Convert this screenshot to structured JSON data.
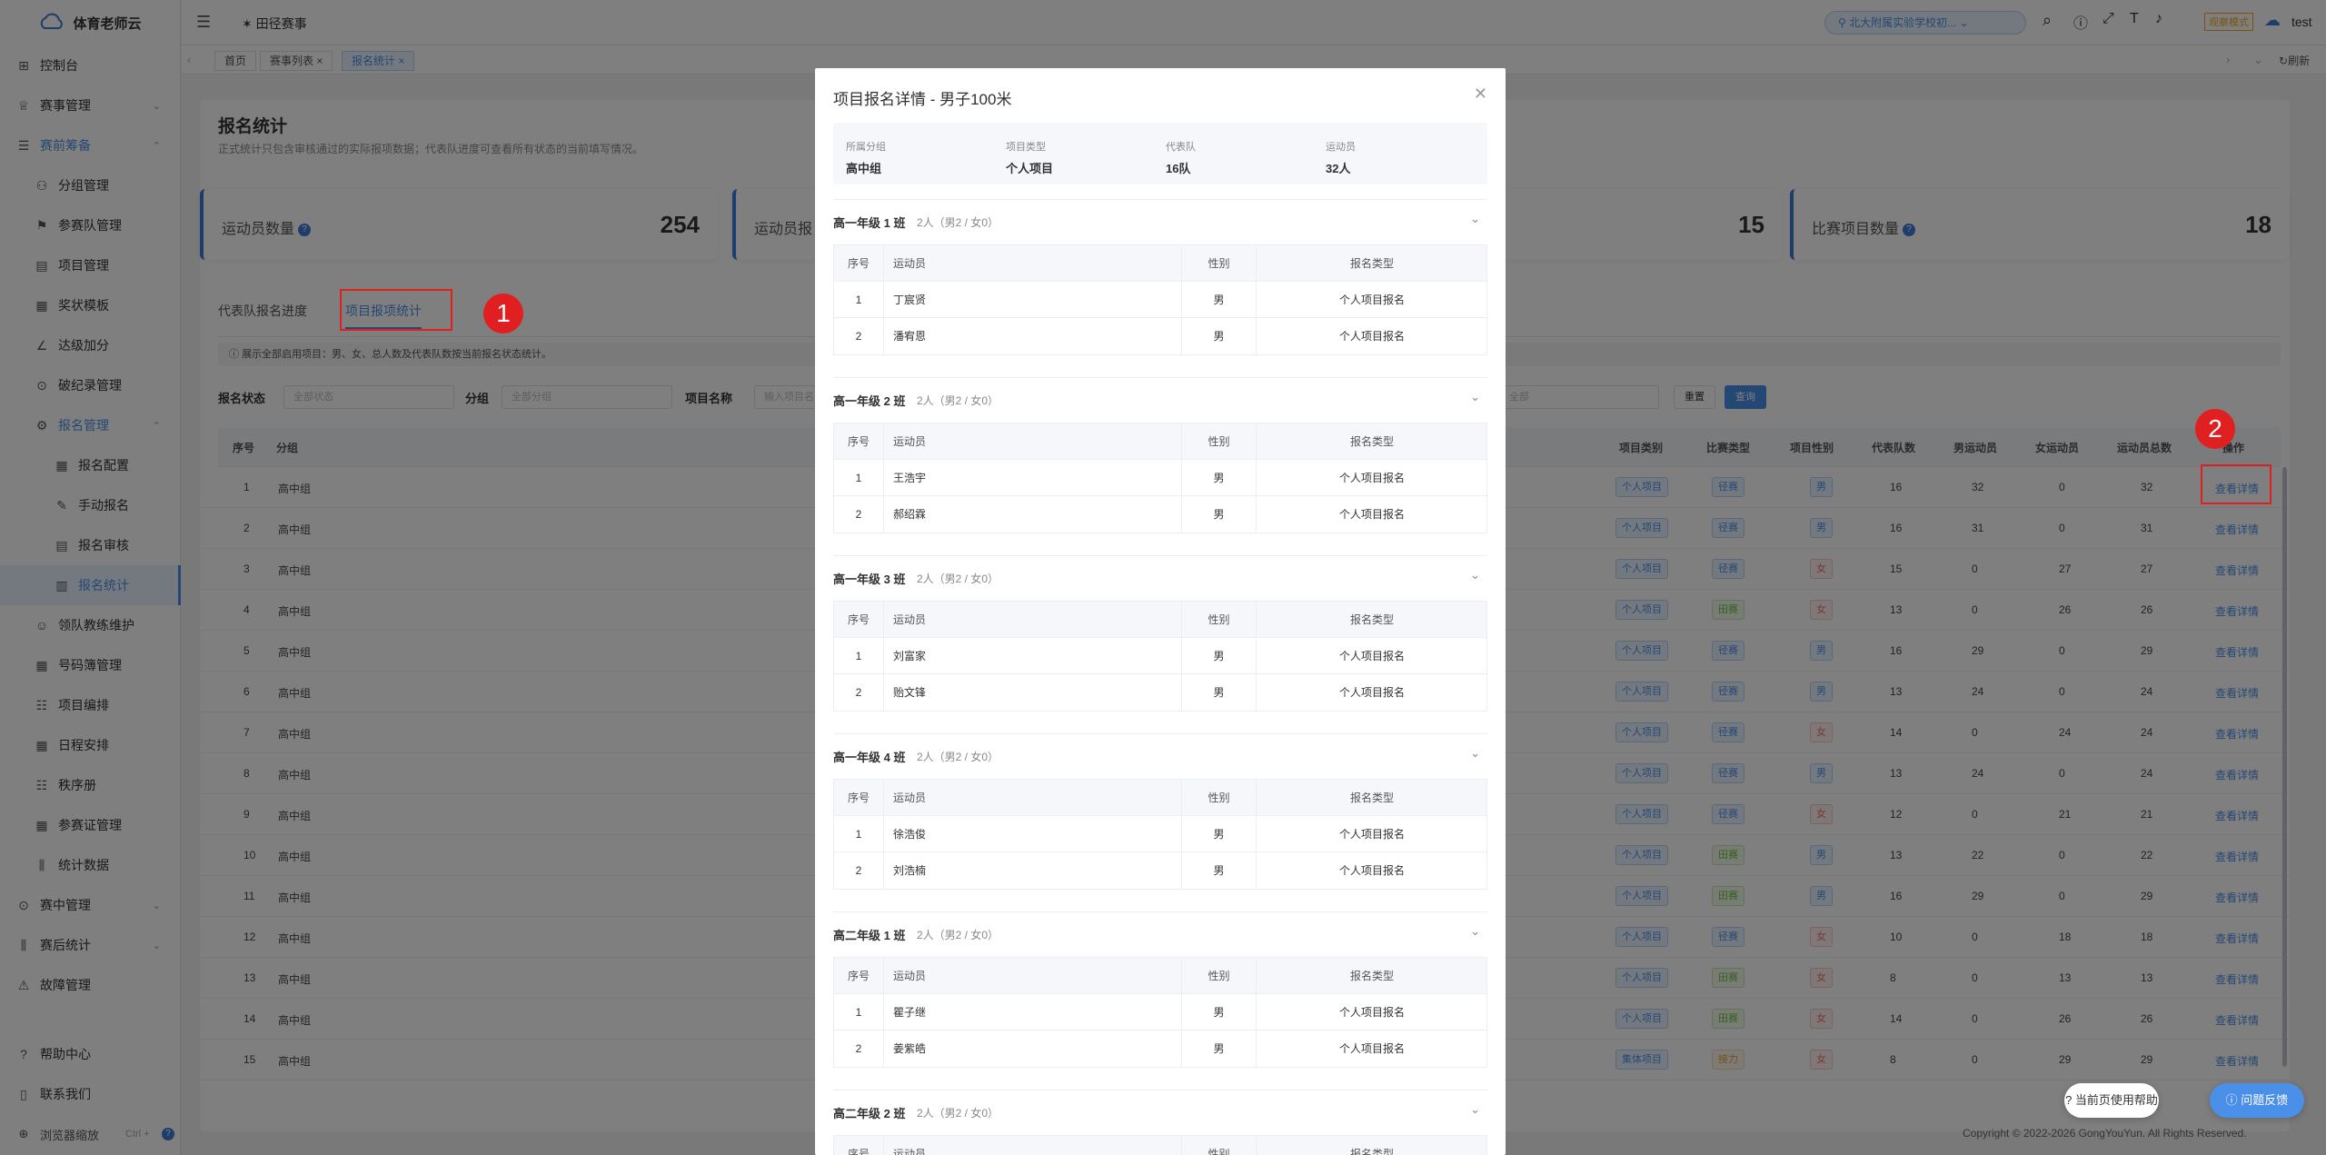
{
  "app": {
    "logo_text": "体育老师云"
  },
  "sidebar": {
    "items": [
      {
        "label": "控制台"
      },
      {
        "label": "赛事管理"
      },
      {
        "label": "赛前筹备"
      },
      {
        "label": "分组管理"
      },
      {
        "label": "参赛队管理"
      },
      {
        "label": "项目管理"
      },
      {
        "label": "奖状模板"
      },
      {
        "label": "达级加分"
      },
      {
        "label": "破纪录管理"
      },
      {
        "label": "报名管理"
      },
      {
        "label": "报名配置"
      },
      {
        "label": "手动报名"
      },
      {
        "label": "报名审核"
      },
      {
        "label": "报名统计"
      },
      {
        "label": "领队教练维护"
      },
      {
        "label": "号码簿管理"
      },
      {
        "label": "项目编排"
      },
      {
        "label": "日程安排"
      },
      {
        "label": "秩序册"
      },
      {
        "label": "参赛证管理"
      },
      {
        "label": "统计数据"
      },
      {
        "label": "赛中管理"
      },
      {
        "label": "赛后统计"
      },
      {
        "label": "故障管理"
      }
    ],
    "footer": {
      "help": "帮助中心",
      "contact": "联系我们",
      "zoom": "浏览器缩放",
      "zoom_hint": "Ctrl +"
    }
  },
  "topbar": {
    "breadcrumb": "田径赛事",
    "school": "北大附属实验学校初...",
    "mode": "观察模式",
    "user": "test"
  },
  "tabs": [
    {
      "label": "首页"
    },
    {
      "label": "赛事列表"
    },
    {
      "label": "报名统计"
    }
  ],
  "tabs_refresh": "刷新",
  "page": {
    "title": "报名统计",
    "subtitle": "正式统计只包含审核通过的实际报项数据；代表队进度可查看所有状态的当前填写情况。",
    "stats": [
      {
        "label": "运动员数量",
        "value": "254"
      },
      {
        "label": "运动员报",
        "value": ""
      },
      {
        "label": "",
        "value": "15"
      },
      {
        "label": "比赛项目数量",
        "value": "18"
      }
    ],
    "subtabs": [
      "代表队报名进度",
      "项目报项统计"
    ],
    "notice": "展示全部启用项目：男、女、总人数及代表队数按当前报名状态统计。",
    "filters": {
      "status_label": "报名状态",
      "status_placeholder": "全部状态",
      "group_label": "分组",
      "group_placeholder": "全部分组",
      "name_label": "项目名称",
      "name_placeholder": "输入项目名",
      "extra_placeholder": "全部",
      "reset": "重置",
      "query": "查询"
    },
    "table": {
      "headers": [
        "序号",
        "分组",
        "项目类别",
        "比赛类型",
        "项目性别",
        "代表队数",
        "男运动员",
        "女运动员",
        "运动员总数",
        "操作"
      ],
      "action": "查看详情",
      "rows": [
        {
          "no": "1",
          "group": "高中组",
          "cat": "个人项目",
          "type": "径赛",
          "sex": "男",
          "teams": "16",
          "m": "32",
          "f": "0",
          "total": "32"
        },
        {
          "no": "2",
          "group": "高中组",
          "cat": "个人项目",
          "type": "径赛",
          "sex": "男",
          "teams": "16",
          "m": "31",
          "f": "0",
          "total": "31"
        },
        {
          "no": "3",
          "group": "高中组",
          "cat": "个人项目",
          "type": "径赛",
          "sex": "女",
          "teams": "15",
          "m": "0",
          "f": "27",
          "total": "27"
        },
        {
          "no": "4",
          "group": "高中组",
          "cat": "个人项目",
          "type": "田赛",
          "sex": "女",
          "teams": "13",
          "m": "0",
          "f": "26",
          "total": "26"
        },
        {
          "no": "5",
          "group": "高中组",
          "cat": "个人项目",
          "type": "径赛",
          "sex": "男",
          "teams": "16",
          "m": "29",
          "f": "0",
          "total": "29"
        },
        {
          "no": "6",
          "group": "高中组",
          "cat": "个人项目",
          "type": "径赛",
          "sex": "男",
          "teams": "13",
          "m": "24",
          "f": "0",
          "total": "24"
        },
        {
          "no": "7",
          "group": "高中组",
          "cat": "个人项目",
          "type": "径赛",
          "sex": "女",
          "teams": "14",
          "m": "0",
          "f": "24",
          "total": "24"
        },
        {
          "no": "8",
          "group": "高中组",
          "cat": "个人项目",
          "type": "径赛",
          "sex": "男",
          "teams": "13",
          "m": "24",
          "f": "0",
          "total": "24"
        },
        {
          "no": "9",
          "group": "高中组",
          "cat": "个人项目",
          "type": "径赛",
          "sex": "女",
          "teams": "12",
          "m": "0",
          "f": "21",
          "total": "21"
        },
        {
          "no": "10",
          "group": "高中组",
          "cat": "个人项目",
          "type": "田赛",
          "sex": "男",
          "teams": "13",
          "m": "22",
          "f": "0",
          "total": "22"
        },
        {
          "no": "11",
          "group": "高中组",
          "cat": "个人项目",
          "type": "田赛",
          "sex": "男",
          "teams": "16",
          "m": "29",
          "f": "0",
          "total": "29"
        },
        {
          "no": "12",
          "group": "高中组",
          "cat": "个人项目",
          "type": "径赛",
          "sex": "女",
          "teams": "10",
          "m": "0",
          "f": "18",
          "total": "18"
        },
        {
          "no": "13",
          "group": "高中组",
          "cat": "个人项目",
          "type": "田赛",
          "sex": "女",
          "teams": "8",
          "m": "0",
          "f": "13",
          "total": "13"
        },
        {
          "no": "14",
          "group": "高中组",
          "cat": "个人项目",
          "type": "田赛",
          "sex": "女",
          "teams": "14",
          "m": "0",
          "f": "26",
          "total": "26"
        },
        {
          "no": "15",
          "group": "高中组",
          "cat": "集体项目",
          "type": "接力",
          "sex": "女",
          "teams": "8",
          "m": "0",
          "f": "29",
          "total": "29"
        }
      ]
    }
  },
  "modal": {
    "title": "项目报名详情 - 男子100米",
    "summary": [
      {
        "k": "所属分组",
        "v": "高中组"
      },
      {
        "k": "项目类型",
        "v": "个人项目"
      },
      {
        "k": "代表队",
        "v": "16队"
      },
      {
        "k": "运动员",
        "v": "32人"
      }
    ],
    "headers": [
      "序号",
      "运动员",
      "性别",
      "报名类型"
    ],
    "sections": [
      {
        "title": "高一年级 1 班",
        "count": "2人（男2 / 女0）",
        "rows": [
          {
            "no": "1",
            "name": "丁宸贤",
            "sex": "男",
            "type": "个人项目报名"
          },
          {
            "no": "2",
            "name": "潘宥恩",
            "sex": "男",
            "type": "个人项目报名"
          }
        ]
      },
      {
        "title": "高一年级 2 班",
        "count": "2人（男2 / 女0）",
        "rows": [
          {
            "no": "1",
            "name": "王浩宇",
            "sex": "男",
            "type": "个人项目报名"
          },
          {
            "no": "2",
            "name": "郝绍霖",
            "sex": "男",
            "type": "个人项目报名"
          }
        ]
      },
      {
        "title": "高一年级 3 班",
        "count": "2人（男2 / 女0）",
        "rows": [
          {
            "no": "1",
            "name": "刘富家",
            "sex": "男",
            "type": "个人项目报名"
          },
          {
            "no": "2",
            "name": "贻文锋",
            "sex": "男",
            "type": "个人项目报名"
          }
        ]
      },
      {
        "title": "高一年级 4 班",
        "count": "2人（男2 / 女0）",
        "rows": [
          {
            "no": "1",
            "name": "徐浩俊",
            "sex": "男",
            "type": "个人项目报名"
          },
          {
            "no": "2",
            "name": "刘浩楠",
            "sex": "男",
            "type": "个人项目报名"
          }
        ]
      },
      {
        "title": "高二年级 1 班",
        "count": "2人（男2 / 女0）",
        "rows": [
          {
            "no": "1",
            "name": "瞿子继",
            "sex": "男",
            "type": "个人项目报名"
          },
          {
            "no": "2",
            "name": "姜紫皓",
            "sex": "男",
            "type": "个人项目报名"
          }
        ]
      },
      {
        "title": "高二年级 2 班",
        "count": "2人（男2 / 女0）",
        "rows": []
      }
    ]
  },
  "annotations": {
    "badge1": "1",
    "badge2": "2"
  },
  "floating": {
    "help": "当前页使用帮助",
    "feedback": "问题反馈"
  },
  "footer": {
    "copyright": "Copyright © 2022-2026 GongYouYun. All Rights Reserved."
  },
  "colors": {
    "accent": "#4a8fe8",
    "annotation": "#e02020"
  }
}
